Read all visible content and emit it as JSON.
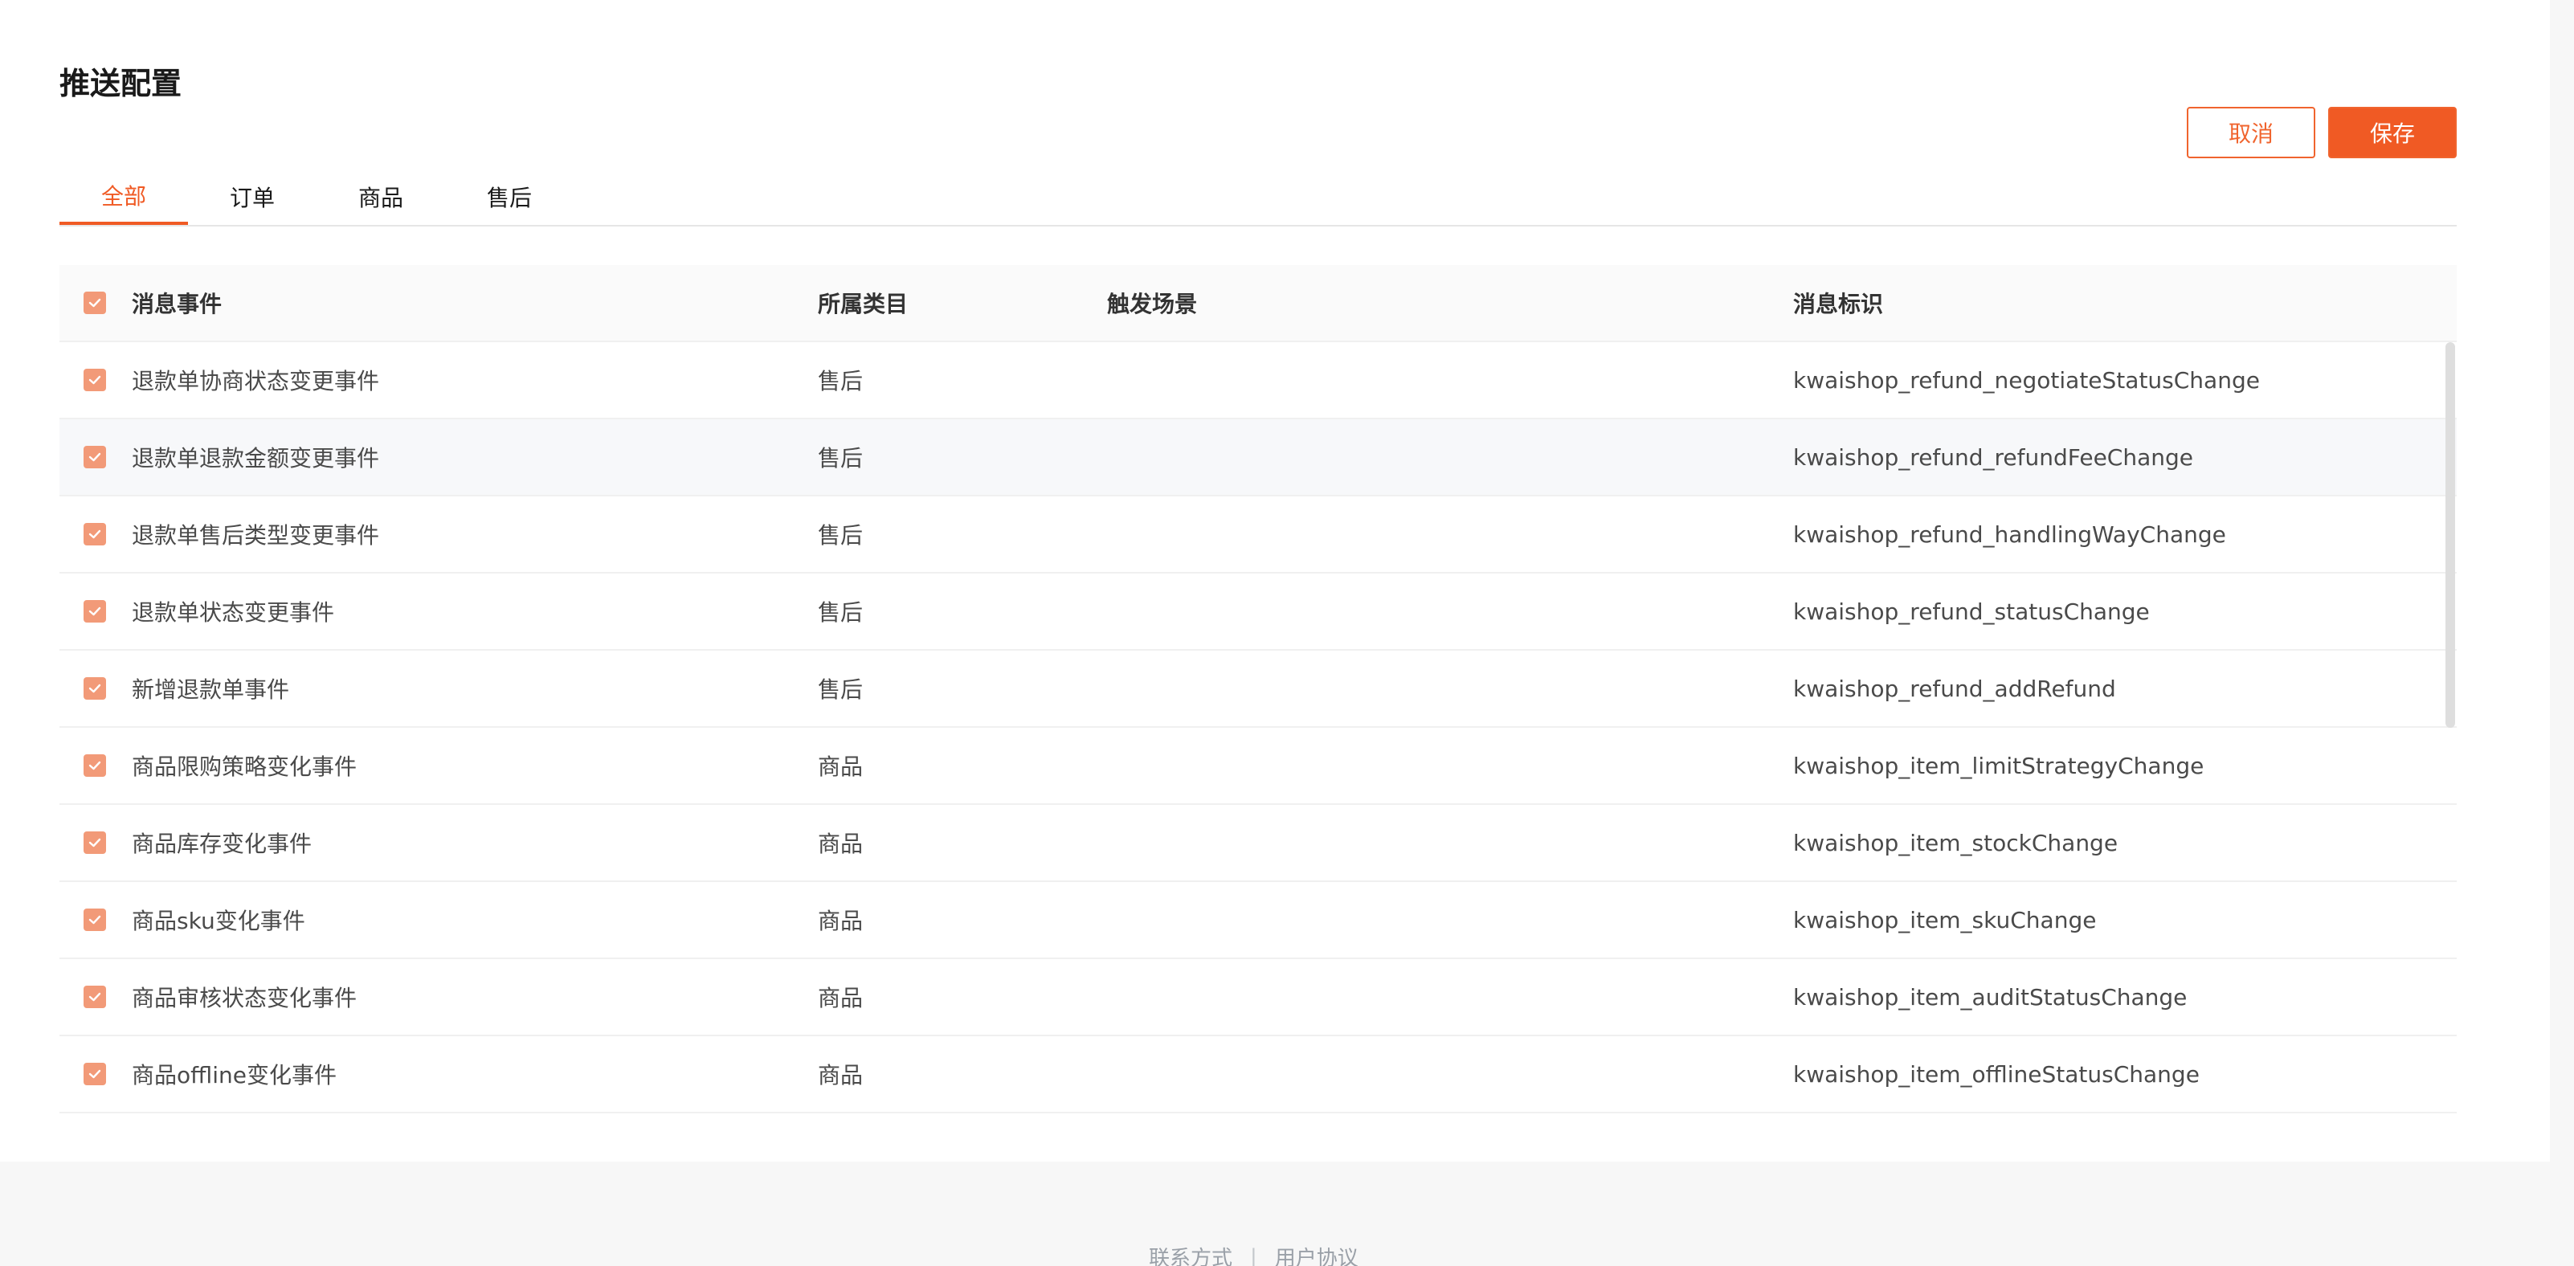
{
  "page": {
    "title": "推送配置"
  },
  "actions": {
    "cancel_label": "取消",
    "save_label": "保存"
  },
  "tabs": [
    {
      "label": "全部",
      "active": true
    },
    {
      "label": "订单",
      "active": false
    },
    {
      "label": "商品",
      "active": false
    },
    {
      "label": "售后",
      "active": false
    }
  ],
  "table": {
    "columns": {
      "event": "消息事件",
      "category": "所属类目",
      "scene": "触发场景",
      "id": "消息标识"
    },
    "select_all_checked": true,
    "rows": [
      {
        "event": "退款单协商状态变更事件",
        "category": "售后",
        "scene": "",
        "id": "kwaishop_refund_negotiateStatusChange",
        "checked": true
      },
      {
        "event": "退款单退款金额变更事件",
        "category": "售后",
        "scene": "",
        "id": "kwaishop_refund_refundFeeChange",
        "checked": true
      },
      {
        "event": "退款单售后类型变更事件",
        "category": "售后",
        "scene": "",
        "id": "kwaishop_refund_handlingWayChange",
        "checked": true
      },
      {
        "event": "退款单状态变更事件",
        "category": "售后",
        "scene": "",
        "id": "kwaishop_refund_statusChange",
        "checked": true
      },
      {
        "event": "新增退款单事件",
        "category": "售后",
        "scene": "",
        "id": "kwaishop_refund_addRefund",
        "checked": true
      },
      {
        "event": "商品限购策略变化事件",
        "category": "商品",
        "scene": "",
        "id": "kwaishop_item_limitStrategyChange",
        "checked": true
      },
      {
        "event": "商品库存变化事件",
        "category": "商品",
        "scene": "",
        "id": "kwaishop_item_stockChange",
        "checked": true
      },
      {
        "event": "商品sku变化事件",
        "category": "商品",
        "scene": "",
        "id": "kwaishop_item_skuChange",
        "checked": true
      },
      {
        "event": "商品审核状态变化事件",
        "category": "商品",
        "scene": "",
        "id": "kwaishop_item_auditStatusChange",
        "checked": true
      },
      {
        "event": "商品offline变化事件",
        "category": "商品",
        "scene": "",
        "id": "kwaishop_item_offlineStatusChange",
        "checked": true
      }
    ]
  },
  "footer": {
    "contact": "联系方式",
    "separator": "|",
    "agreement": "用户协议"
  },
  "colors": {
    "accent": "#f05a24",
    "checkbox": "#f29a78",
    "footer_bg": "#f7f7f7"
  },
  "icons": {
    "checkbox": "check-icon"
  }
}
